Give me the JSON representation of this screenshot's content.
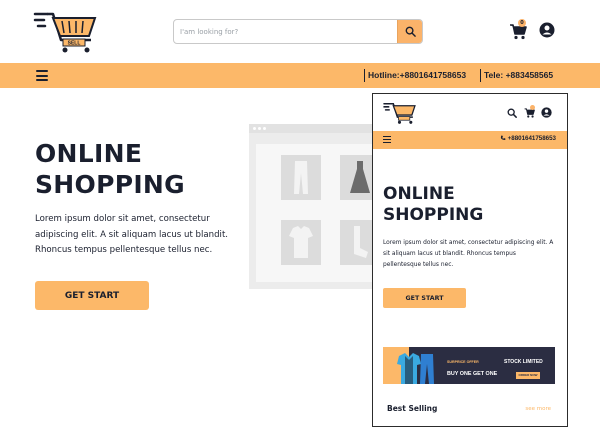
{
  "header": {
    "logo_tag": "SELL",
    "search_placeholder": "I'am looking for?",
    "cart_count": "0"
  },
  "navbar": {
    "hotline": "Hotline:+8801641758653",
    "tele": "Tele: +883458565"
  },
  "hero": {
    "title_line1": "ONLINE",
    "title_line2": "SHOPPING",
    "description": "Lorem ipsum dolor sit amet, consectetur adipiscing elit. A sit aliquam lacus ut blandit. Rhoncus tempus pellentesque tellus nec.",
    "button_label": "GET START"
  },
  "mobile_preview": {
    "phone_number": "+8801641758653",
    "title_line1": "ONLINE",
    "title_line2": "SHOPPING",
    "description": "Lorem ipsum dolor sit amet, consectetur adipiscing elit. A sit aliquam lacus ut blandit. Rhoncus tempus pellentesque tellus nec.",
    "button_label": "GET START",
    "banner": {
      "small_text": "SURPRICE OFFER",
      "big_text": "BUY ONE GET ONE",
      "stock_text": "STOCK LIMITED",
      "order_label": "ORDER NOW"
    },
    "best_selling": "Best Selling",
    "see_more": "see more"
  },
  "colors": {
    "accent": "#fcb869",
    "dark": "#1a1f2e",
    "banner_bg": "#2b2d42"
  }
}
